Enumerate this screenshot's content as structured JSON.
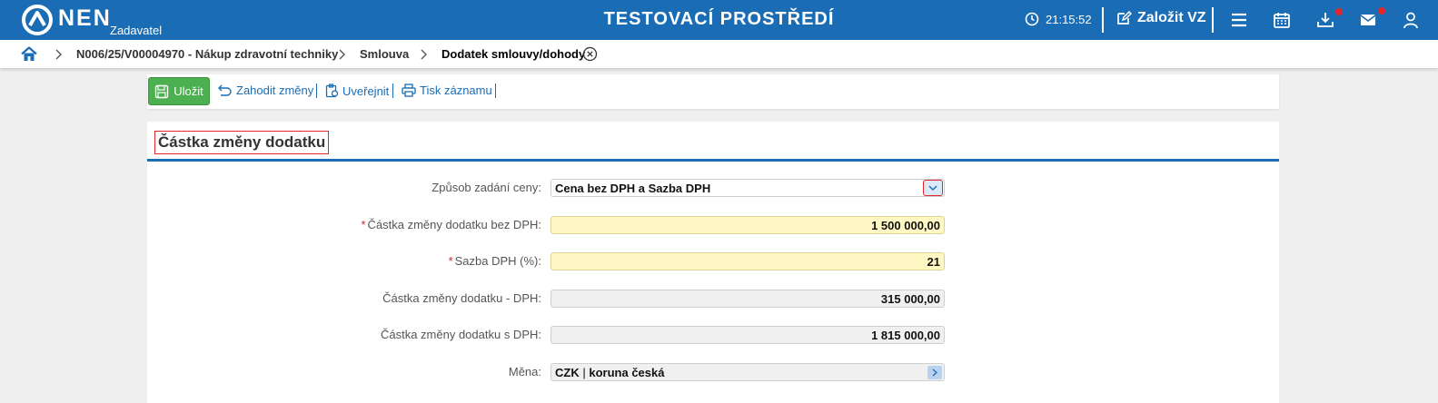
{
  "header": {
    "logo_text": "NEN",
    "logo_sub": "Zadavatel",
    "environment_title": "TESTOVACÍ PROSTŘEDÍ",
    "clock": "21:15:52",
    "create_label": "Založit VZ"
  },
  "breadcrumb": {
    "items": [
      "N006/25/V00004970 - Nákup zdravotní techniky",
      "Smlouva"
    ],
    "current": "Dodatek smlouvy/dohody"
  },
  "toolbar": {
    "save_label": "Uložit",
    "discard_label": "Zahodit změny",
    "publish_label": "Uveřejnit",
    "print_label": "Tisk záznamu"
  },
  "panel": {
    "title": "Částka změny dodatku"
  },
  "form": {
    "price_mode": {
      "label": "Způsob zadání ceny:",
      "value": "Cena bez DPH a Sazba DPH"
    },
    "amount_without_vat": {
      "label": "Částka změny dodatku bez DPH:",
      "value": "1 500 000,00",
      "required": true
    },
    "vat_rate": {
      "label": "Sazba DPH (%):",
      "value": "21",
      "required": true
    },
    "vat_amount": {
      "label": "Částka změny dodatku - DPH:",
      "value": "315 000,00"
    },
    "amount_with_vat": {
      "label": "Částka změny dodatku s DPH:",
      "value": "1 815 000,00"
    },
    "currency": {
      "label": "Měna:",
      "code": "CZK",
      "separator": "|",
      "name": "koruna česká"
    }
  },
  "colors": {
    "primary": "#1a6db5",
    "save_green": "#4caf50",
    "required_input_bg": "#fff8c4",
    "readonly_bg": "#f0f0f0",
    "notification_red": "#e4262c"
  }
}
